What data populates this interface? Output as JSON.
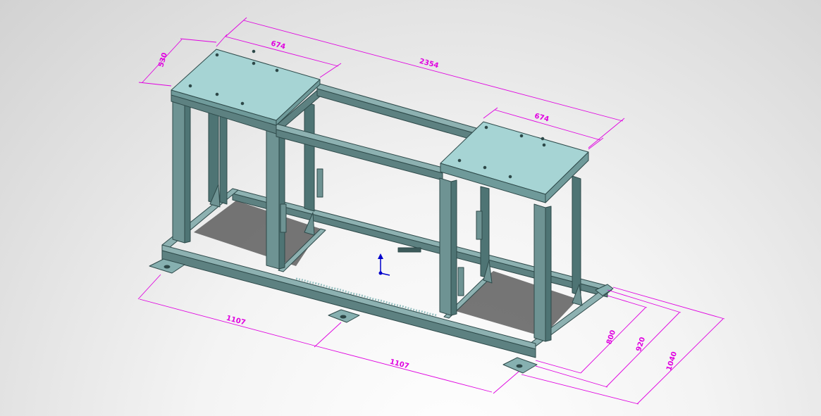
{
  "drawing": {
    "type": "3D CAD isometric view of a steel frame stand with two top plates",
    "colors": {
      "frame": "#6e9393",
      "plate_top": "#a6d4d4",
      "dimension": "#e000e0",
      "origin_y": "#0000cc"
    },
    "dimensions": {
      "plate_depth_left": "530",
      "plate_width_left": "674",
      "overall_length": "2354",
      "plate_width_right": "674",
      "bottom_length_left": "1107",
      "bottom_length_right": "1107",
      "width_inner": "800",
      "width_mid": "920",
      "width_outer": "1040"
    }
  }
}
